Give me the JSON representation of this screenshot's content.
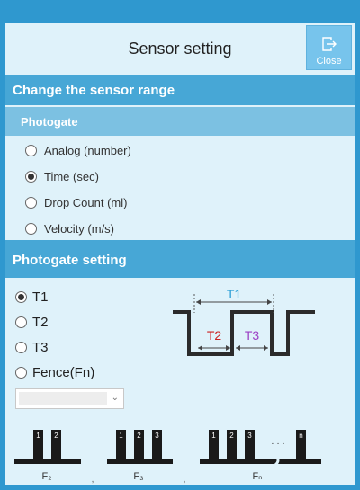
{
  "dialog": {
    "title": "Sensor setting",
    "close_label": "Close"
  },
  "sensor_range": {
    "heading": "Change the sensor range",
    "group": "Photogate",
    "options": [
      {
        "label": "Analog (number)",
        "checked": false
      },
      {
        "label": "Time (sec)",
        "checked": true
      },
      {
        "label": "Drop Count (ml)",
        "checked": false
      },
      {
        "label": "Velocity (m/s)",
        "checked": false
      }
    ]
  },
  "photogate_setting": {
    "heading": "Photogate setting",
    "options": [
      {
        "label": "T1",
        "checked": true
      },
      {
        "label": "T2",
        "checked": false
      },
      {
        "label": "T3",
        "checked": false
      },
      {
        "label": "Fence(Fn)",
        "checked": false
      }
    ],
    "fence_select_value": ""
  },
  "timing_diagram": {
    "t1_label": "T1",
    "t2_label": "T2",
    "t3_label": "T3",
    "t1_color": "#2a9fd6",
    "t2_color": "#cc1f1f",
    "t3_color": "#9b3fc4"
  },
  "fences": {
    "f2": {
      "teeth": [
        "1",
        "2"
      ],
      "label": "F₂"
    },
    "f3": {
      "teeth": [
        "1",
        "2",
        "3"
      ],
      "label": "F₃"
    },
    "fn": {
      "teeth": [
        "1",
        "2",
        "3",
        "n"
      ],
      "dots": "· · ·",
      "label": "Fₙ"
    },
    "separator": ","
  },
  "colors": {
    "frame": "#2f98cf",
    "panel": "#dff2fa",
    "band_dark": "#47a7d6",
    "band_light": "#7cc1e2"
  }
}
